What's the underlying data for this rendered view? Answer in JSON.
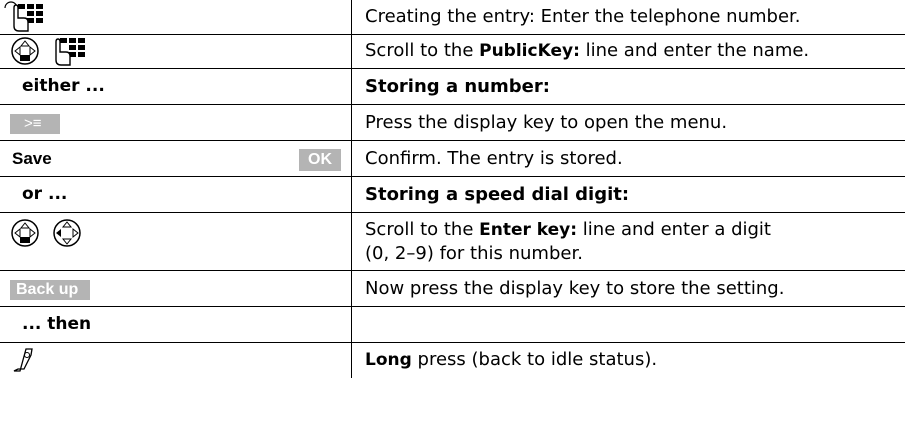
{
  "rows": [
    {
      "right": "Creating the entry: Enter the telephone number.",
      "icons": [
        "keypad-icon"
      ]
    },
    {
      "right_prefix": "Scroll to the ",
      "right_bold": "PublicKey:",
      "right_suffix": " line and enter the name.",
      "icons": [
        "nav-key-icon",
        "keypad-icon"
      ]
    },
    {
      "left": "either ...",
      "right": "Storing a number:"
    },
    {
      "right": "Press the display key to open the menu.",
      "left_pill": "˃≡"
    },
    {
      "left": "Save",
      "left_pill": "OK",
      "right": "Confirm. The entry is stored."
    },
    {
      "left": "or ...",
      "right": "Storing a speed dial digit:"
    },
    {
      "right_prefix": "Scroll to the ",
      "right_bold": "Enter key:",
      "right_suffix": " line and enter a digit",
      "right_line2": "(0, 2–9) for this number.",
      "icons": [
        "nav-key-icon",
        "nav-key-down-icon"
      ]
    },
    {
      "left_pill": "Back up",
      "right": "Now press the display key to store the setting."
    },
    {
      "left": "... then",
      "right": ""
    },
    {
      "right_bold": "Long",
      "right_suffix": " press (back to idle status).",
      "icons": [
        "end-call-icon"
      ]
    }
  ]
}
